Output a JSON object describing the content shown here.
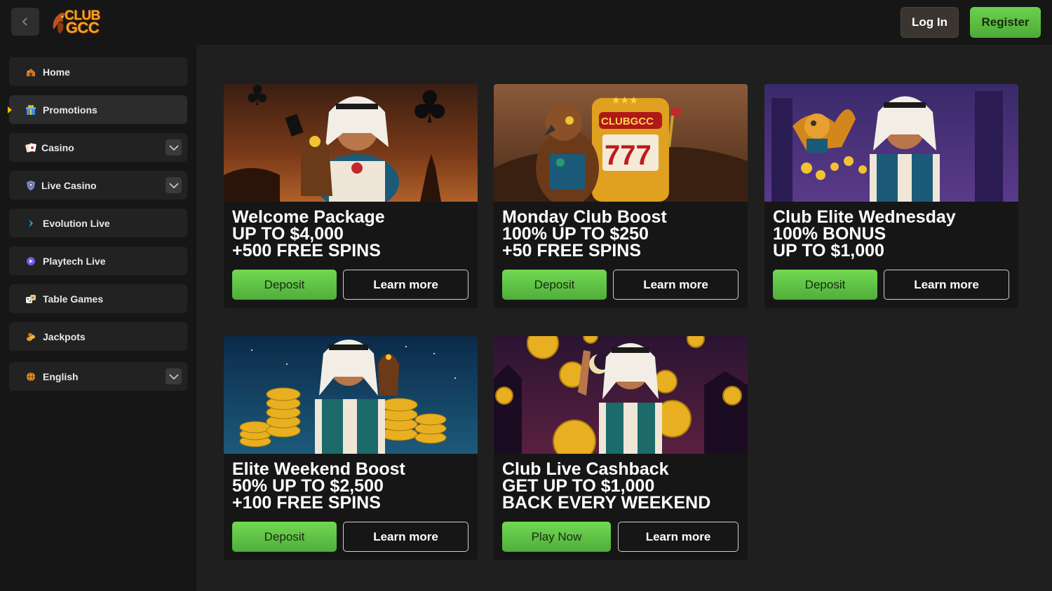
{
  "header": {
    "logo_text_top": "CLUB",
    "logo_text_bottom": "GCC",
    "login_label": "Log In",
    "register_label": "Register"
  },
  "sidebar": {
    "items": [
      {
        "label": "Home",
        "icon": "home-icon",
        "has_chevron": false
      },
      {
        "label": "Promotions",
        "icon": "gift-icon",
        "has_chevron": false,
        "active": true
      },
      {
        "label": "Casino",
        "icon": "cards-icon",
        "has_chevron": true
      },
      {
        "label": "Live Casino",
        "icon": "live-shield-icon",
        "has_chevron": true
      },
      {
        "label": "Evolution Live",
        "icon": "evolution-icon",
        "has_chevron": false
      },
      {
        "label": "Playtech Live",
        "icon": "playtech-icon",
        "has_chevron": false
      },
      {
        "label": "Table Games",
        "icon": "dice-icon",
        "has_chevron": false
      },
      {
        "label": "Jackpots",
        "icon": "coins-icon",
        "has_chevron": false
      },
      {
        "label": "English",
        "icon": "globe-icon",
        "has_chevron": true
      }
    ]
  },
  "promos": [
    {
      "line1": "Welcome Package",
      "line2": "UP TO $4,000",
      "line3": "+500 FREE SPINS",
      "primary": "Deposit",
      "secondary": "Learn more"
    },
    {
      "line1": "Monday Club Boost",
      "line2": "100% UP TO $250",
      "line3": "+50 FREE SPINS",
      "primary": "Deposit",
      "secondary": "Learn more",
      "banner_text": "CLUBGCC"
    },
    {
      "line1": "Club Elite Wednesday",
      "line2": "100% BONUS",
      "line3": "UP TO $1,000",
      "primary": "Deposit",
      "secondary": "Learn more"
    },
    {
      "line1": "Elite Weekend Boost",
      "line2": "50% UP TO $2,500",
      "line3": "+100 FREE SPINS",
      "primary": "Deposit",
      "secondary": "Learn more"
    },
    {
      "line1": "Club Live Cashback",
      "line2": "GET UP TO $1,000",
      "line3": "BACK EVERY WEEKEND",
      "primary": "Play Now",
      "secondary": "Learn more"
    }
  ],
  "colors": {
    "accent_green": "#5cc244",
    "background": "#1f1f1f",
    "panel": "#161616",
    "active_marker": "#f5b800"
  }
}
